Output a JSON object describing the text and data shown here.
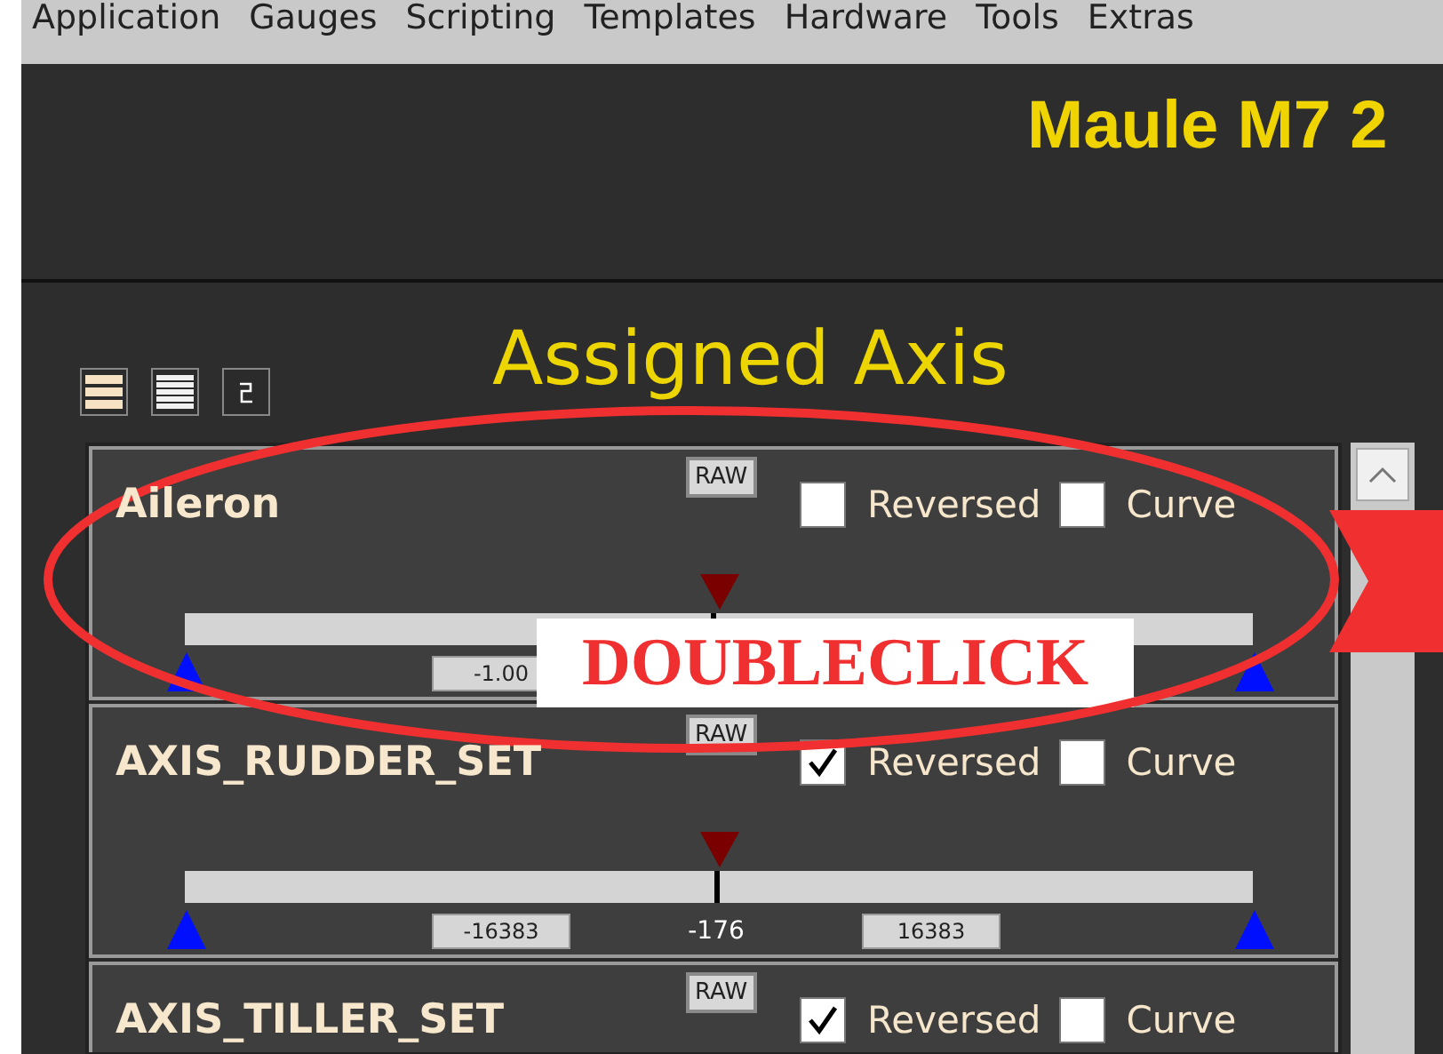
{
  "menu": [
    "Application",
    "Gauges",
    "Scripting",
    "Templates",
    "Hardware",
    "Tools",
    "Extras"
  ],
  "header": {
    "title": "Maule M7 2"
  },
  "section": {
    "title": "Assigned Axis"
  },
  "axes": [
    {
      "name": "Aileron",
      "raw": "RAW",
      "reversed": false,
      "curve": false,
      "reversed_label": "Reversed",
      "curve_label": "Curve",
      "level": 0.495,
      "min": "-1.00"
    },
    {
      "name": "AXIS_RUDDER_SET",
      "raw": "RAW",
      "reversed": true,
      "curve": false,
      "reversed_label": "Reversed",
      "curve_label": "Curve",
      "level": 0.497,
      "min": "-16383",
      "value": "-176",
      "max": "16383"
    },
    {
      "name": "AXIS_TILLER_SET",
      "raw": "RAW",
      "reversed": true,
      "curve": false,
      "reversed_label": "Reversed",
      "curve_label": "Curve"
    }
  ],
  "annotation": {
    "label": "DOUBLECLICK"
  }
}
